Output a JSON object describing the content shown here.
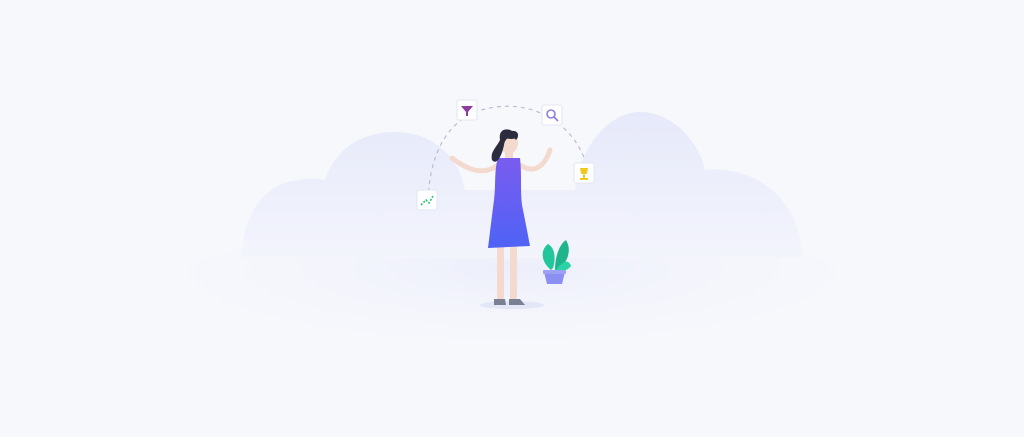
{
  "illustration": {
    "subject": "woman-juggling-analytics-icons",
    "icons": [
      "trend-chart-icon",
      "funnel-icon",
      "magnifier-icon",
      "trophy-icon"
    ],
    "colors": {
      "background": "#f7f8fc",
      "cloud": "#e9ecfb",
      "floor_shadow": "#eef0fb",
      "dress": "#5b5ef0",
      "hair": "#2b2d3e",
      "skin": "#f4d9cf",
      "funnel": "#8e3c9e",
      "magnifier": "#8c7fe0",
      "trophy": "#f2c71c",
      "trend": "#2fbf71",
      "plant_leaf": "#23c59a",
      "plant_pot": "#8b8ff2",
      "dash_arc": "#b9bdd2"
    }
  }
}
